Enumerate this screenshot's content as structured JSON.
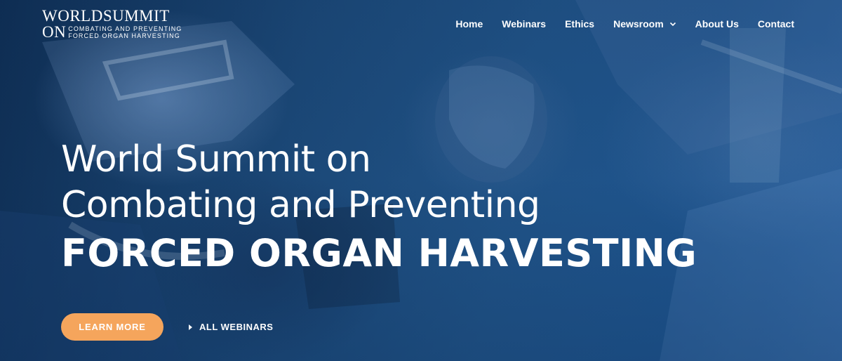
{
  "logo": {
    "top": "WORLDSUMMIT",
    "on": "ON",
    "sub_line1": "COMBATING AND PREVENTING",
    "sub_line2": "FORCED ORGAN HARVESTING"
  },
  "nav": {
    "items": [
      {
        "label": "Home"
      },
      {
        "label": "Webinars"
      },
      {
        "label": "Ethics"
      },
      {
        "label": "Newsroom",
        "has_dropdown": true
      },
      {
        "label": "About Us"
      },
      {
        "label": "Contact"
      }
    ]
  },
  "hero": {
    "line1": "World Summit on",
    "line2": "Combating and Preventing",
    "line3": "FORCED ORGAN HARVESTING"
  },
  "cta": {
    "learn_more": "LEARN MORE",
    "all_webinars": "ALL WEBINARS"
  },
  "colors": {
    "accent": "#f5a55c",
    "background": "#1d4a78",
    "text": "#ffffff"
  }
}
